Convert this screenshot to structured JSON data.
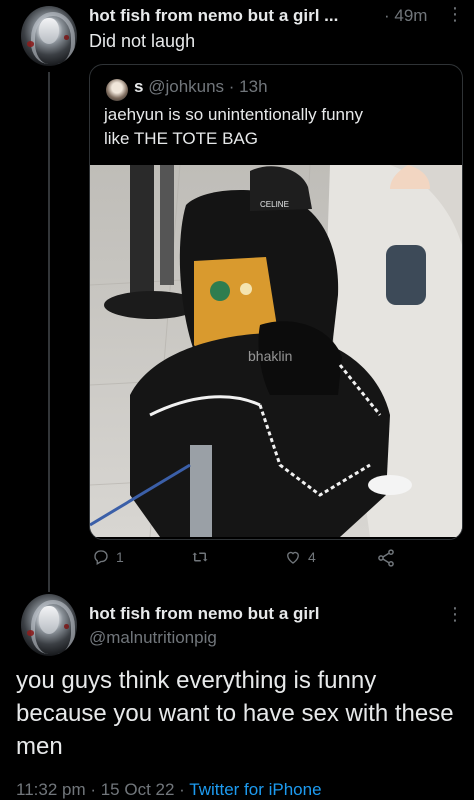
{
  "first_tweet": {
    "display_name": "hot fish from nemo but a girl ...",
    "time": "· 49m",
    "text": "Did not laugh"
  },
  "quoted_tweet": {
    "name": "s",
    "handle": "@johkuns",
    "time": "· 13h",
    "text_line1": "jaehyun is so unintentionally funny",
    "text_line2": "like THE TOTE BAG",
    "image_watermark": "bhaklin",
    "cap_logo": "CELINE"
  },
  "actions": {
    "reply_count": "1",
    "like_count": "4",
    "icons": [
      "reply-icon",
      "retweet-icon",
      "heart-icon",
      "share-icon"
    ]
  },
  "main_tweet": {
    "display_name": "hot fish from nemo but a girl",
    "handle": "@malnutritionpig",
    "text": "you guys think everything is funny because you want to have sex with these men",
    "timestamp": "11:32 pm · 15 Oct 22 ·",
    "source": "Twitter for iPhone"
  },
  "colors": {
    "background": "#000000",
    "text": "#e7e9ea",
    "muted": "#71767b",
    "link": "#1d9bf0",
    "border": "#2f3336"
  }
}
